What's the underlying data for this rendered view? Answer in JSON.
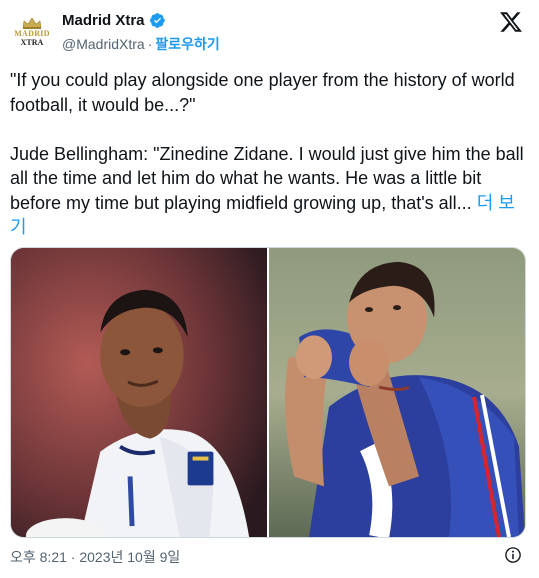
{
  "author": {
    "display_name": "Madrid Xtra",
    "handle": "@MadridXtra",
    "separator": "·",
    "follow_label": "팔로우하기",
    "avatar_line1": "MADRID",
    "avatar_line2": "XTRA",
    "verified_color": "#1d9bf0"
  },
  "tweet": {
    "text": "\"If you could play alongside one player from the history of world football, it would be...?\"\n\nJude Bellingham: \"Zinedine Zidane. I would just give him the ball all the time and let him do what he wants. He was a little bit before my time but playing midfield growing up, that's all...",
    "show_more": "더 보기"
  },
  "media": {
    "photos": [
      "photo-bellingham",
      "photo-zidane"
    ]
  },
  "footer": {
    "timestamp": "오후 8:21 · 2023년 10월 9일"
  },
  "icons": {
    "brand": "x-logo-icon",
    "info": "info-icon",
    "verified": "verified-badge-icon"
  },
  "colors": {
    "link": "#1d9bf0",
    "secondary_text": "#536471",
    "primary_text": "#0f1419"
  }
}
